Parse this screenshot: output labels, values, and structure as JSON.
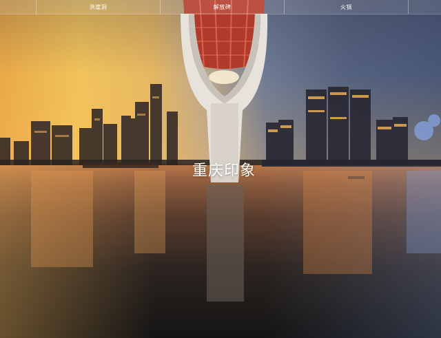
{
  "nav": {
    "items": [
      {
        "label": "洪崖洞"
      },
      {
        "label": "解放碑"
      },
      {
        "label": "火锅"
      }
    ]
  },
  "hero": {
    "title": "重庆印象"
  },
  "background": {
    "subject": "bridge-and-skyline-photo",
    "colors": {
      "sunset": "#f1c35a",
      "dusk": "#55627f",
      "bridge_red": "#c8412c"
    }
  }
}
